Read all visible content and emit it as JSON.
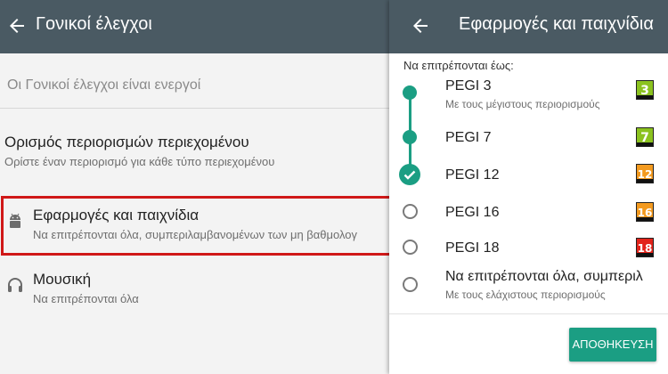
{
  "left_panel": {
    "title": "Γονικοί έλεγχοι",
    "status": "Οι Γονικοί έλεγχοι είναι ενεργοί",
    "settings": [
      {
        "title": "Ορισμός περιορισμών περιεχομένου",
        "subtitle": "Ορίστε έναν περιορισμό για κάθε τύπο περιεχομένου"
      },
      {
        "title": "Εφαρμογές και παιχνίδια",
        "subtitle": "Να επιτρέπονται όλα, συμπεριλαμβανομένων των μη βαθμολογ",
        "icon": "android-icon"
      },
      {
        "title": "Μουσική",
        "subtitle": "Να επιτρέπονται όλα",
        "icon": "headphones-icon"
      }
    ]
  },
  "right_panel": {
    "title": "Εφαρμογές και παιχνίδια",
    "allowed_label": "Να επιτρέπονται έως:",
    "selected_index": 2,
    "options": [
      {
        "title": "PEGI 3",
        "subtitle": "Με τους μέγιστους περιορισμούς",
        "badge": "3",
        "badge_color": "#8bc21f"
      },
      {
        "title": "PEGI 7",
        "badge": "7",
        "badge_color": "#8bc21f"
      },
      {
        "title": "PEGI 12",
        "badge": "12",
        "badge_color": "#f39a1f"
      },
      {
        "title": "PEGI 16",
        "badge": "16",
        "badge_color": "#f39a1f"
      },
      {
        "title": "PEGI 18",
        "badge": "18",
        "badge_color": "#e2231a"
      },
      {
        "title": "Να επιτρέπονται όλα, συμπεριλ",
        "subtitle": "Με τους ελάχιστους περιορισμούς"
      }
    ],
    "save_label": "ΑΠΟΘΗΚΕΥΣΗ"
  },
  "colors": {
    "appbar": "#4a5a63",
    "accent": "#1b9e83",
    "highlight_border": "#d01818"
  }
}
